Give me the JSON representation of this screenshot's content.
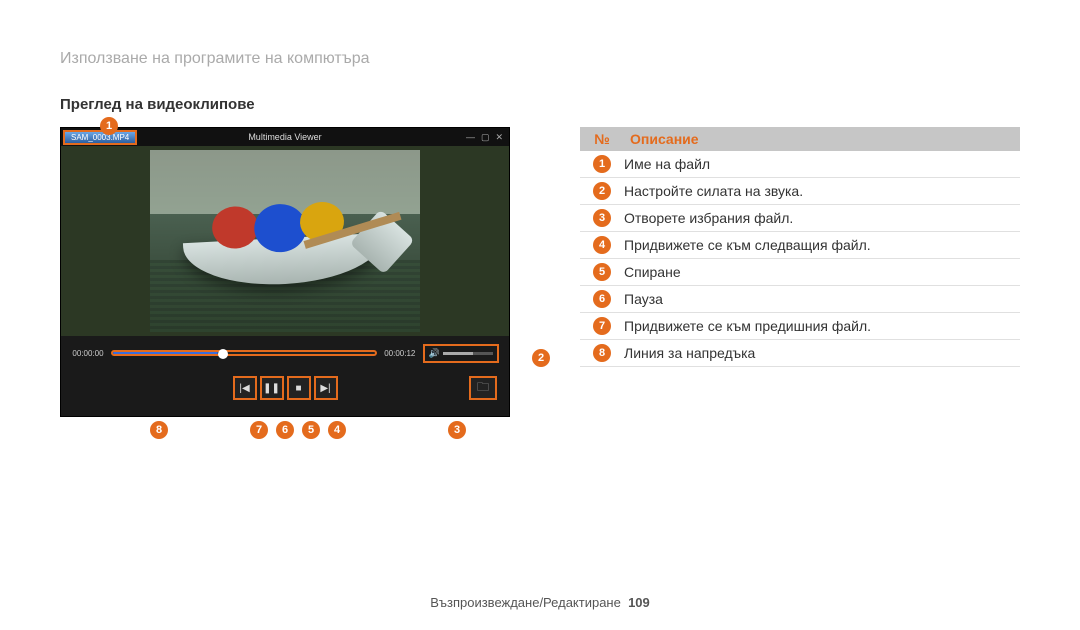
{
  "breadcrumb": "Използване на програмите на компютъра",
  "section_title": "Преглед на видеоклипове",
  "player": {
    "file_name": "SAM_0003.MP4",
    "window_title": "Multimedia Viewer",
    "time_elapsed": "00:00:00",
    "time_total": "00:00:12"
  },
  "callouts": {
    "c1": "1",
    "c2": "2",
    "c3": "3",
    "c4": "4",
    "c5": "5",
    "c6": "6",
    "c7": "7",
    "c8": "8"
  },
  "table": {
    "header_num": "№",
    "header_desc": "Описание",
    "rows": [
      {
        "n": "1",
        "t": "Име на файл"
      },
      {
        "n": "2",
        "t": "Настройте силата на звука."
      },
      {
        "n": "3",
        "t": "Отворете избрания файл."
      },
      {
        "n": "4",
        "t": "Придвижете се към следващия файл."
      },
      {
        "n": "5",
        "t": "Спиране"
      },
      {
        "n": "6",
        "t": "Пауза"
      },
      {
        "n": "7",
        "t": "Придвижете се към предишния файл."
      },
      {
        "n": "8",
        "t": "Линия за напредъка"
      }
    ]
  },
  "footer": {
    "section": "Възпроизвеждане/Редактиране",
    "page": "109"
  }
}
